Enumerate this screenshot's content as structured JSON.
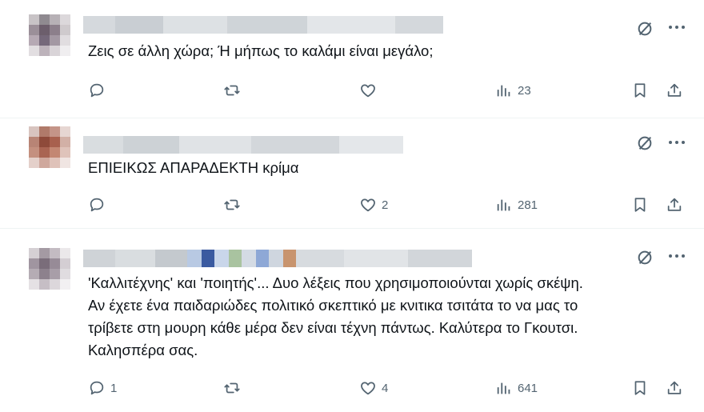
{
  "posts": [
    {
      "text_lines": [
        "Ζεις σε άλλη χώρα; Ή μήπως το καλάμι είναι μεγάλο;"
      ],
      "replies": "",
      "reposts": "",
      "likes": "",
      "views": "23"
    },
    {
      "text_lines": [
        "ΕΠΙΕΙΚΩΣ ΑΠΑΡΑΔΕΚΤΗ κρίμα"
      ],
      "replies": "",
      "reposts": "",
      "likes": "2",
      "views": "281"
    },
    {
      "text_lines": [
        "'Καλλιτέχνης' και 'ποιητής'... Δυο λέξεις που χρησιμοποιούνται χωρίς σκέψη.",
        "Αν έχετε ένα παιδαριώδες πολιτικό σκεπτικό με κνιτικα τσιτάτα το να μας το",
        "τρίβετε στη μουρη κάθε μέρα δεν είναι τέχνη πάντως. Καλύτερα το Γκουτσι.",
        "Καλησπέρα σας."
      ],
      "replies": "1",
      "reposts": "",
      "likes": "4",
      "views": "641"
    }
  ],
  "icons": {
    "reply": "reply-icon",
    "repost": "repost-icon",
    "like": "heart-icon",
    "views": "views-icon",
    "bookmark": "bookmark-icon",
    "share": "share-icon",
    "grok": "grok-icon",
    "more": "more-icon"
  },
  "colors": {
    "icon": "#536471",
    "text": "#0f1419",
    "divider": "#eff3f4"
  }
}
